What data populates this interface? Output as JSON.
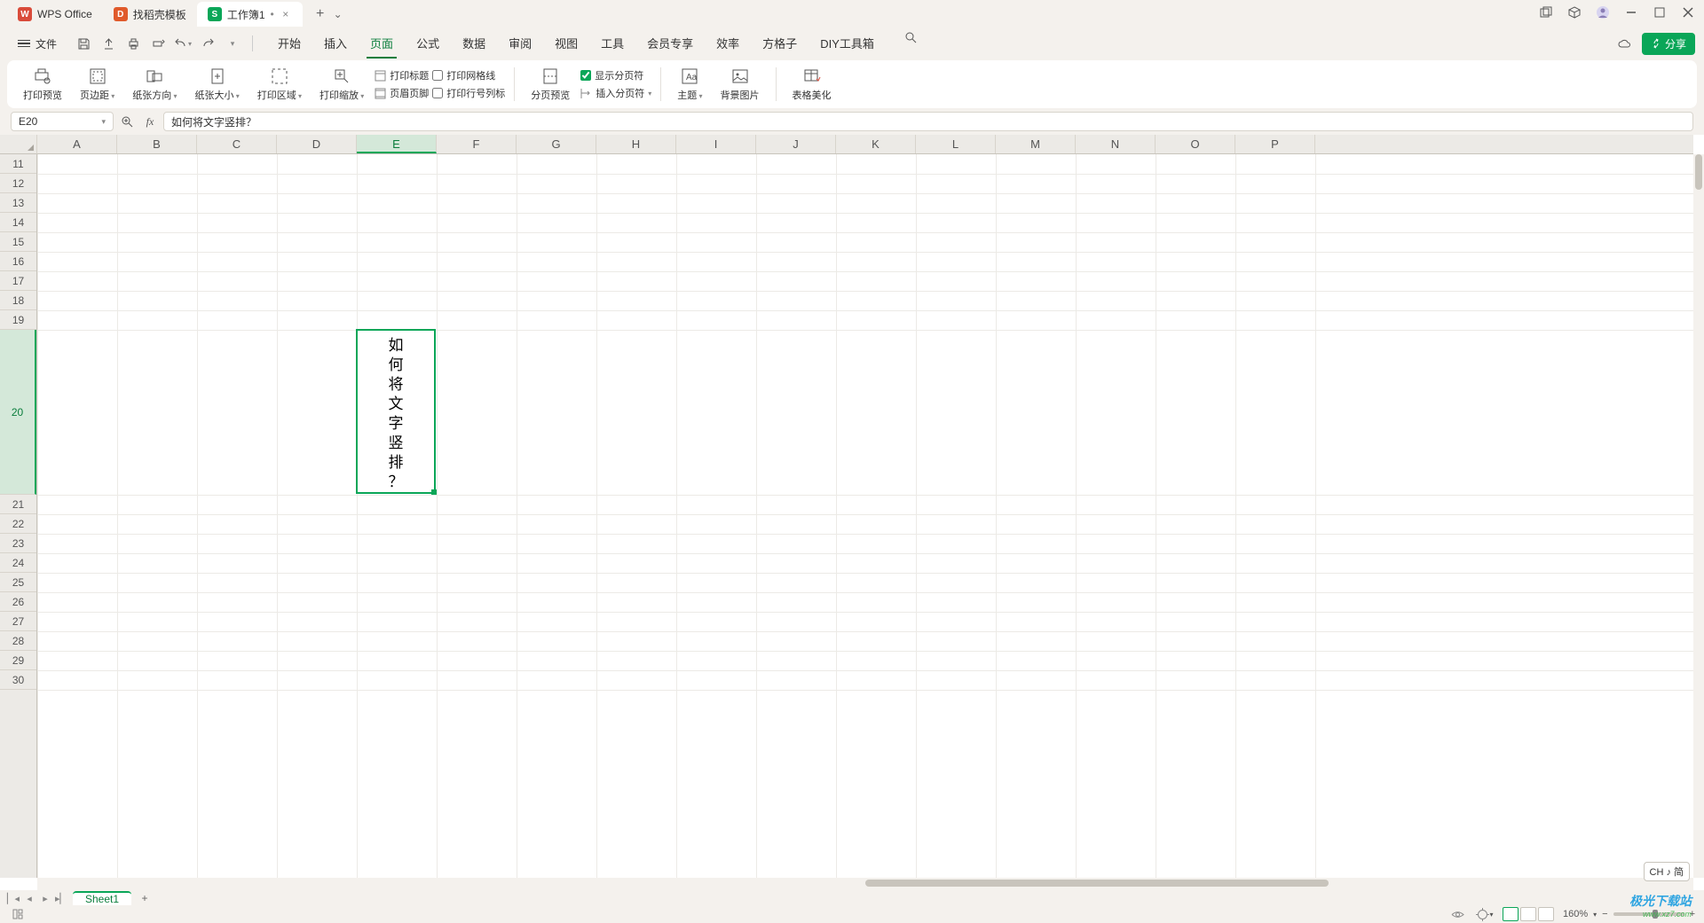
{
  "titlebar": {
    "tabs": [
      {
        "label": "WPS Office",
        "icon_color": "#d94b3a",
        "icon_text": "W"
      },
      {
        "label": "找稻壳模板",
        "icon_color": "#e05a2b",
        "icon_text": "D"
      },
      {
        "label": "工作簿1",
        "icon_color": "#0aa658",
        "icon_text": "S",
        "dirty": "•",
        "active": true
      }
    ],
    "add": "+",
    "dd": "⌄"
  },
  "menubar": {
    "file": "文件",
    "items": [
      "开始",
      "插入",
      "页面",
      "公式",
      "数据",
      "审阅",
      "视图",
      "工具",
      "会员专享",
      "效率",
      "方格子",
      "DIY工具箱"
    ],
    "active_index": 2,
    "share": "分享"
  },
  "ribbon": {
    "print_preview": "打印预览",
    "margins": "页边距",
    "orientation": "纸张方向",
    "size": "纸张大小",
    "print_area": "打印区域",
    "print_zoom": "打印缩放",
    "checks1": {
      "print_title": "打印标题",
      "header_footer": "页眉页脚"
    },
    "checks2": {
      "gridlines": "打印网格线",
      "row_col": "打印行号列标"
    },
    "page_preview": "分页预览",
    "insert_break": "插入分页符",
    "show_page_chars": "显示分页符",
    "theme": "主题",
    "bg_image": "背景图片",
    "beautify": "表格美化"
  },
  "formula": {
    "namebox": "E20",
    "content": "如何将文字竖排？"
  },
  "sheet": {
    "cols": [
      "A",
      "B",
      "C",
      "D",
      "E",
      "F",
      "G",
      "H",
      "I",
      "J",
      "K",
      "L",
      "M",
      "N",
      "O",
      "P"
    ],
    "selected_col_index": 4,
    "row_start": 11,
    "row_count": 20,
    "selected_row": 20,
    "cell_chars": [
      "如",
      "何",
      "将",
      "文",
      "字",
      "竖",
      "排",
      "？"
    ],
    "sheet_tab": "Sheet1"
  },
  "status": {
    "zoom": "160%",
    "ime": "CH ♪ 简"
  },
  "watermark": {
    "brand": "极光下载站",
    "url": "www.xz7.com"
  }
}
